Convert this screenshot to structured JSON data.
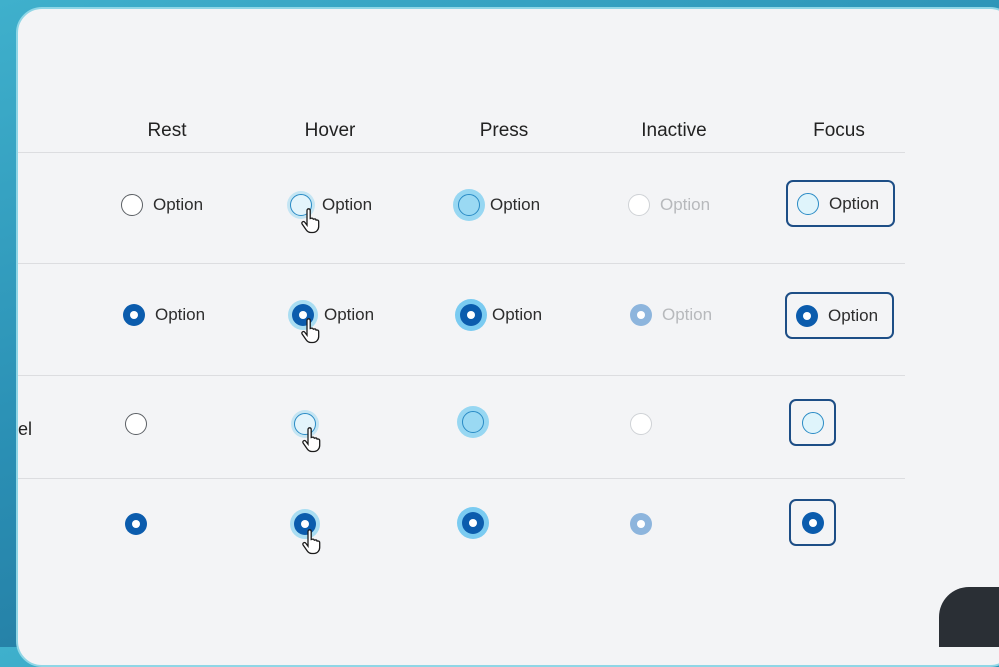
{
  "columns": [
    "Rest",
    "Hover",
    "Press",
    "Inactive",
    "Focus"
  ],
  "option_label": "Option",
  "partial_row_label": "el",
  "cursor_icon": "hand-pointer-icon",
  "colors": {
    "selected": "#0b5cad",
    "focus_border": "#1d4e86",
    "hover_halo": "#8cd2f0",
    "inactive_selected": "#8db5dd"
  }
}
